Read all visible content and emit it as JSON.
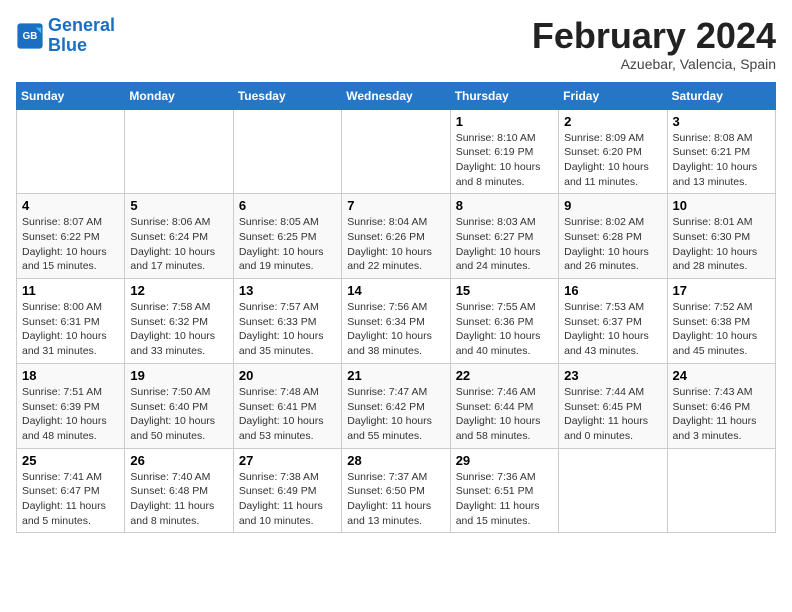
{
  "header": {
    "logo_line1": "General",
    "logo_line2": "Blue",
    "title": "February 2024",
    "subtitle": "Azuebar, Valencia, Spain"
  },
  "weekdays": [
    "Sunday",
    "Monday",
    "Tuesday",
    "Wednesday",
    "Thursday",
    "Friday",
    "Saturday"
  ],
  "weeks": [
    [
      {
        "day": "",
        "info": ""
      },
      {
        "day": "",
        "info": ""
      },
      {
        "day": "",
        "info": ""
      },
      {
        "day": "",
        "info": ""
      },
      {
        "day": "1",
        "info": "Sunrise: 8:10 AM\nSunset: 6:19 PM\nDaylight: 10 hours\nand 8 minutes."
      },
      {
        "day": "2",
        "info": "Sunrise: 8:09 AM\nSunset: 6:20 PM\nDaylight: 10 hours\nand 11 minutes."
      },
      {
        "day": "3",
        "info": "Sunrise: 8:08 AM\nSunset: 6:21 PM\nDaylight: 10 hours\nand 13 minutes."
      }
    ],
    [
      {
        "day": "4",
        "info": "Sunrise: 8:07 AM\nSunset: 6:22 PM\nDaylight: 10 hours\nand 15 minutes."
      },
      {
        "day": "5",
        "info": "Sunrise: 8:06 AM\nSunset: 6:24 PM\nDaylight: 10 hours\nand 17 minutes."
      },
      {
        "day": "6",
        "info": "Sunrise: 8:05 AM\nSunset: 6:25 PM\nDaylight: 10 hours\nand 19 minutes."
      },
      {
        "day": "7",
        "info": "Sunrise: 8:04 AM\nSunset: 6:26 PM\nDaylight: 10 hours\nand 22 minutes."
      },
      {
        "day": "8",
        "info": "Sunrise: 8:03 AM\nSunset: 6:27 PM\nDaylight: 10 hours\nand 24 minutes."
      },
      {
        "day": "9",
        "info": "Sunrise: 8:02 AM\nSunset: 6:28 PM\nDaylight: 10 hours\nand 26 minutes."
      },
      {
        "day": "10",
        "info": "Sunrise: 8:01 AM\nSunset: 6:30 PM\nDaylight: 10 hours\nand 28 minutes."
      }
    ],
    [
      {
        "day": "11",
        "info": "Sunrise: 8:00 AM\nSunset: 6:31 PM\nDaylight: 10 hours\nand 31 minutes."
      },
      {
        "day": "12",
        "info": "Sunrise: 7:58 AM\nSunset: 6:32 PM\nDaylight: 10 hours\nand 33 minutes."
      },
      {
        "day": "13",
        "info": "Sunrise: 7:57 AM\nSunset: 6:33 PM\nDaylight: 10 hours\nand 35 minutes."
      },
      {
        "day": "14",
        "info": "Sunrise: 7:56 AM\nSunset: 6:34 PM\nDaylight: 10 hours\nand 38 minutes."
      },
      {
        "day": "15",
        "info": "Sunrise: 7:55 AM\nSunset: 6:36 PM\nDaylight: 10 hours\nand 40 minutes."
      },
      {
        "day": "16",
        "info": "Sunrise: 7:53 AM\nSunset: 6:37 PM\nDaylight: 10 hours\nand 43 minutes."
      },
      {
        "day": "17",
        "info": "Sunrise: 7:52 AM\nSunset: 6:38 PM\nDaylight: 10 hours\nand 45 minutes."
      }
    ],
    [
      {
        "day": "18",
        "info": "Sunrise: 7:51 AM\nSunset: 6:39 PM\nDaylight: 10 hours\nand 48 minutes."
      },
      {
        "day": "19",
        "info": "Sunrise: 7:50 AM\nSunset: 6:40 PM\nDaylight: 10 hours\nand 50 minutes."
      },
      {
        "day": "20",
        "info": "Sunrise: 7:48 AM\nSunset: 6:41 PM\nDaylight: 10 hours\nand 53 minutes."
      },
      {
        "day": "21",
        "info": "Sunrise: 7:47 AM\nSunset: 6:42 PM\nDaylight: 10 hours\nand 55 minutes."
      },
      {
        "day": "22",
        "info": "Sunrise: 7:46 AM\nSunset: 6:44 PM\nDaylight: 10 hours\nand 58 minutes."
      },
      {
        "day": "23",
        "info": "Sunrise: 7:44 AM\nSunset: 6:45 PM\nDaylight: 11 hours\nand 0 minutes."
      },
      {
        "day": "24",
        "info": "Sunrise: 7:43 AM\nSunset: 6:46 PM\nDaylight: 11 hours\nand 3 minutes."
      }
    ],
    [
      {
        "day": "25",
        "info": "Sunrise: 7:41 AM\nSunset: 6:47 PM\nDaylight: 11 hours\nand 5 minutes."
      },
      {
        "day": "26",
        "info": "Sunrise: 7:40 AM\nSunset: 6:48 PM\nDaylight: 11 hours\nand 8 minutes."
      },
      {
        "day": "27",
        "info": "Sunrise: 7:38 AM\nSunset: 6:49 PM\nDaylight: 11 hours\nand 10 minutes."
      },
      {
        "day": "28",
        "info": "Sunrise: 7:37 AM\nSunset: 6:50 PM\nDaylight: 11 hours\nand 13 minutes."
      },
      {
        "day": "29",
        "info": "Sunrise: 7:36 AM\nSunset: 6:51 PM\nDaylight: 11 hours\nand 15 minutes."
      },
      {
        "day": "",
        "info": ""
      },
      {
        "day": "",
        "info": ""
      }
    ]
  ]
}
